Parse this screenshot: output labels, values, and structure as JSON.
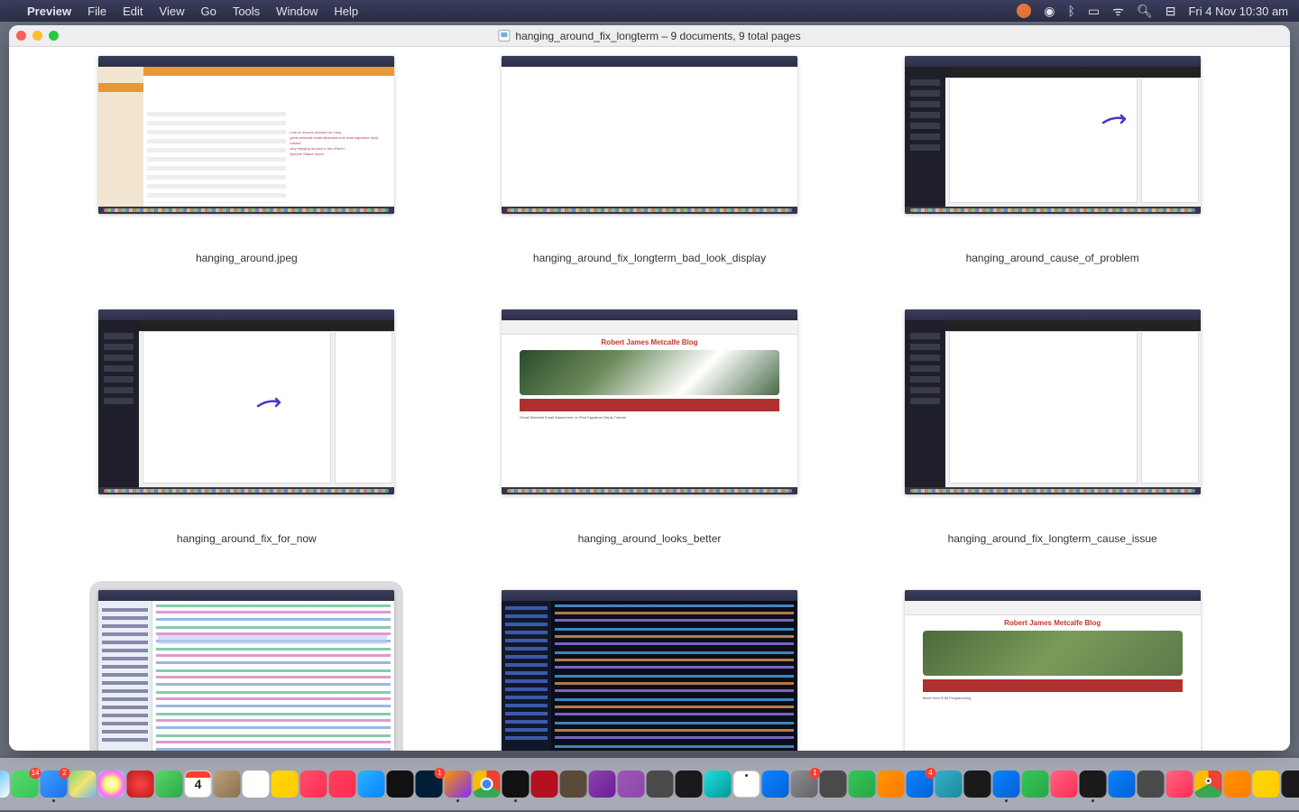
{
  "menubar": {
    "app": "Preview",
    "items": [
      "File",
      "Edit",
      "View",
      "Go",
      "Tools",
      "Window",
      "Help"
    ],
    "clock": "Fri 4 Nov  10:30 am"
  },
  "window": {
    "title": "hanging_around_fix_longterm – 9 documents, 9 total pages"
  },
  "thumbnails": [
    {
      "caption": "hanging_around.jpeg",
      "kind": "apache",
      "selected": false
    },
    {
      "caption": "hanging_around_fix_longterm_bad_look_display",
      "kind": "white",
      "selected": false
    },
    {
      "caption": "hanging_around_cause_of_problem",
      "kind": "wp",
      "arrow": "top",
      "selected": false
    },
    {
      "caption": "hanging_around_fix_for_now",
      "kind": "wp",
      "arrow": "mid",
      "selected": false
    },
    {
      "caption": "hanging_around_looks_better",
      "kind": "blog-trees",
      "selected": false
    },
    {
      "caption": "hanging_around_fix_longterm_cause_issue",
      "kind": "wp",
      "selected": false
    },
    {
      "caption": "",
      "kind": "code-light",
      "selected": true
    },
    {
      "caption": "",
      "kind": "code-dark",
      "selected": false
    },
    {
      "caption": "",
      "kind": "blog-green",
      "selected": false
    }
  ],
  "blog_title": "Robert James Metcalfe Blog",
  "dock_badges": {
    "messages": "14",
    "mail": "2",
    "ps": "1",
    "systempref": "1",
    "bluegeneric": "4"
  }
}
